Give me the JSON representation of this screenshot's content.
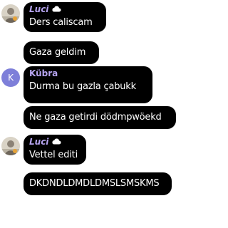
{
  "messages": [
    {
      "sender": "Luci",
      "text": "Ders caliscam"
    },
    {
      "text": "Gaza geldim"
    },
    {
      "sender": "Kübra",
      "avatar_letter": "K",
      "text": "Durma bu gazla çabukk"
    },
    {
      "text": "Ne gaza getirdi dödmpwöekd"
    },
    {
      "sender": "Luci",
      "text": "Vettel editi"
    },
    {
      "text": "DKDNDLDMDLDMSLSMSKMS"
    }
  ],
  "colors": {
    "bubble": "#000000",
    "sender_name": "#b6a4f0",
    "avatar_k": "#7e7fd9"
  },
  "icons": {
    "cloud": "cloud-icon"
  }
}
